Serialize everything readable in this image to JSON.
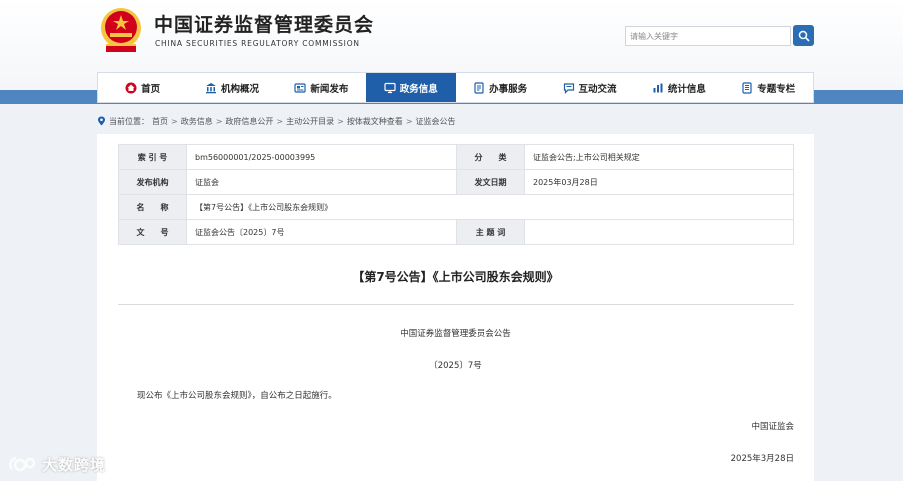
{
  "header": {
    "title_cn": "中国证券监督管理委员会",
    "title_en": "CHINA SECURITIES REGULATORY COMMISSION",
    "search_placeholder": "请输入关键字"
  },
  "nav": {
    "items": [
      {
        "label": "首页",
        "icon": "home-icon"
      },
      {
        "label": "机构概况",
        "icon": "building-icon"
      },
      {
        "label": "新闻发布",
        "icon": "news-icon"
      },
      {
        "label": "政务信息",
        "icon": "monitor-icon",
        "active": true
      },
      {
        "label": "办事服务",
        "icon": "service-icon"
      },
      {
        "label": "互动交流",
        "icon": "chat-icon"
      },
      {
        "label": "统计信息",
        "icon": "chart-icon"
      },
      {
        "label": "专题专栏",
        "icon": "topic-icon"
      }
    ]
  },
  "breadcrumb": {
    "prefix": "当前位置：",
    "items": [
      "首页",
      "政务信息",
      "政府信息公开",
      "主动公开目录",
      "按体裁文种查看",
      "证监会公告"
    ]
  },
  "meta": {
    "index_label": "索 引 号",
    "index_value": "bm56000001/2025-00003995",
    "category_label": "分　　类",
    "category_value": "证监会公告;上市公司相关规定",
    "publisher_label": "发布机构",
    "publisher_value": "证监会",
    "date_label": "发文日期",
    "date_value": "2025年03月28日",
    "name_label": "名　　称",
    "name_value": "【第7号公告】《上市公司股东会规则》",
    "docno_label": "文　　号",
    "docno_value": "证监会公告〔2025〕7号",
    "subject_label": "主 题 词",
    "subject_value": ""
  },
  "document": {
    "title": "【第7号公告】《上市公司股东会规则》",
    "issuer": "中国证券监督管理委员会公告",
    "number": "〔2025〕7号",
    "body": "现公布《上市公司股东会规则》，自公布之日起施行。",
    "sign_org": "中国证监会",
    "sign_date": "2025年3月28日"
  },
  "watermark": {
    "text": "大数跨境"
  },
  "colors": {
    "brand_blue": "#1f5ea8",
    "band_blue": "#4f86c2",
    "emblem_red": "#d0021b",
    "emblem_gold": "#f5c542"
  }
}
